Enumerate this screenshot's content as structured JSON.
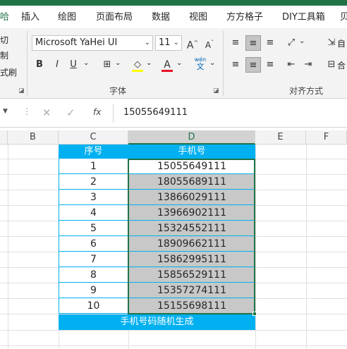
{
  "ribbon_tabs": [
    "哈",
    "插入",
    "绘图",
    "页面布局",
    "数据",
    "视图",
    "方方格子",
    "DIY工具箱",
    "贝"
  ],
  "clipboard": {
    "cut": "切",
    "copy": "制",
    "format_painter": "式刷"
  },
  "font": {
    "name": "Microsoft YaHei UI",
    "size": "11",
    "grow": "A",
    "shrink": "A",
    "bold": "B",
    "italic": "I",
    "underline": "U",
    "color_letter": "A",
    "phonetic_top": "wén",
    "phonetic_bottom": "文",
    "group_label": "字体",
    "fill_color": "#ffff00",
    "font_color": "#e81123"
  },
  "alignment": {
    "group_label": "对齐方式",
    "wrap_label": "自",
    "merge_label": "合"
  },
  "formula_bar": {
    "fx": "fx",
    "value": "15055649111",
    "cancel": "✕",
    "enter": "✓"
  },
  "columns": [
    "B",
    "C",
    "D",
    "E",
    "F"
  ],
  "table": {
    "header_c": "序号",
    "header_d": "手机号",
    "rows": [
      {
        "n": "1",
        "phone": "15055649111"
      },
      {
        "n": "2",
        "phone": "18055689111"
      },
      {
        "n": "3",
        "phone": "13866029111"
      },
      {
        "n": "4",
        "phone": "13966902111"
      },
      {
        "n": "5",
        "phone": "15324552111"
      },
      {
        "n": "6",
        "phone": "18909662111"
      },
      {
        "n": "7",
        "phone": "15862995111"
      },
      {
        "n": "8",
        "phone": "15856529111"
      },
      {
        "n": "9",
        "phone": "15357274111"
      },
      {
        "n": "10",
        "phone": "15155698111"
      }
    ],
    "footer": "手机号码随机生成"
  },
  "colors": {
    "accent": "#217346",
    "table_header": "#00b0f0",
    "selection_fill": "#c8c8c8"
  }
}
